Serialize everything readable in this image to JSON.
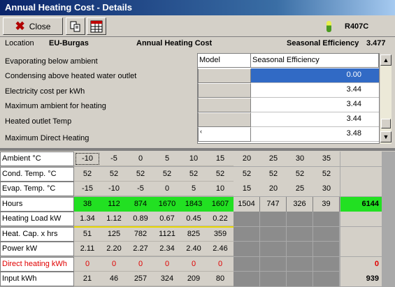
{
  "window": {
    "title": "Annual Heating Cost - Details"
  },
  "toolbar": {
    "close_label": "Close",
    "refrigerant": "R407C"
  },
  "info": {
    "location_label": "Location",
    "location_value": "EU-Burgas",
    "title": "Annual Heating Cost",
    "seasonal_label": "Seasonal Efficiency",
    "seasonal_value": "3.477"
  },
  "params": {
    "labels": [
      "Evaporating below ambient",
      "Condensing above heated water outlet",
      "Electricity cost per kWh",
      "Maximum ambient for heating",
      "Heated outlet Temp",
      "Maximum Direct Heating"
    ],
    "headers": {
      "model": "Model",
      "efficiency": "Seasonal Efficiency"
    },
    "rows": [
      {
        "model": "",
        "efficiency": "0.00"
      },
      {
        "model": "",
        "efficiency": "3.44"
      },
      {
        "model": "",
        "efficiency": "3.44"
      },
      {
        "model": "",
        "efficiency": "3.44"
      },
      {
        "model": "‹",
        "efficiency": "3.48"
      }
    ]
  },
  "grid": {
    "columns": 10,
    "rows": [
      {
        "label": "Ambient °C",
        "values": [
          "-10",
          "-5",
          "0",
          "5",
          "10",
          "15",
          "20",
          "25",
          "30",
          "35"
        ],
        "total": ""
      },
      {
        "label": "Cond. Temp. °C",
        "values": [
          "52",
          "52",
          "52",
          "52",
          "52",
          "52",
          "52",
          "52",
          "52",
          "52"
        ],
        "total": ""
      },
      {
        "label": "Evap. Temp. °C",
        "values": [
          "-15",
          "-10",
          "-5",
          "0",
          "5",
          "10",
          "15",
          "20",
          "25",
          "30"
        ],
        "total": ""
      },
      {
        "label": "Hours",
        "values": [
          "38",
          "112",
          "874",
          "1670",
          "1843",
          "1607",
          "1504",
          "747",
          "326",
          "39"
        ],
        "total": "6144"
      },
      {
        "label": "Heating Load kW",
        "values": [
          "1.34",
          "1.12",
          "0.89",
          "0.67",
          "0.45",
          "0.22",
          "",
          "",
          "",
          ""
        ],
        "total": ""
      },
      {
        "label": "Heat. Cap. x hrs",
        "values": [
          "51",
          "125",
          "782",
          "1121",
          "825",
          "359",
          "",
          "",
          "",
          ""
        ],
        "total": ""
      },
      {
        "label": "Power kW",
        "values": [
          "2.11",
          "2.20",
          "2.27",
          "2.34",
          "2.40",
          "2.46",
          "",
          "",
          "",
          ""
        ],
        "total": ""
      },
      {
        "label": "Direct heating kWh",
        "values": [
          "0",
          "0",
          "0",
          "0",
          "0",
          "0",
          "",
          "",
          "",
          ""
        ],
        "total": "0"
      },
      {
        "label": "Input kWh",
        "values": [
          "21",
          "46",
          "257",
          "324",
          "209",
          "80",
          "",
          "",
          "",
          ""
        ],
        "total": "939"
      }
    ]
  },
  "colors": {
    "green": "#22e022",
    "red": "#e00000",
    "selection": "#316ac5"
  }
}
